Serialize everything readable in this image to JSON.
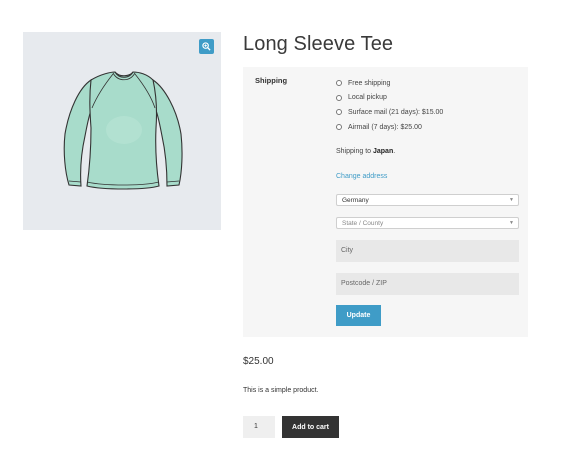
{
  "product": {
    "title": "Long Sleeve Tee",
    "price": "$25.00",
    "description": "This is a simple product.",
    "quantity": "1",
    "add_to_cart_label": "Add to cart",
    "image_icon": "long-sleeve-shirt"
  },
  "shipping": {
    "label": "Shipping",
    "options": [
      "Free shipping",
      "Local pickup",
      "Surface mail (21 days): $15.00",
      "Airmail (7 days): $25.00"
    ],
    "shipping_to_prefix": "Shipping to ",
    "shipping_to_country": "Japan",
    "shipping_to_suffix": ".",
    "change_address_label": "Change address",
    "country_value": "Germany",
    "state_placeholder": "State / County",
    "city_placeholder": "City",
    "postcode_placeholder": "Postcode / ZIP",
    "update_label": "Update"
  },
  "colors": {
    "accent": "#3f9cc7",
    "button_dark": "#333333",
    "gallery_bg": "#e7eaee",
    "shirt": "#a8dccb"
  }
}
